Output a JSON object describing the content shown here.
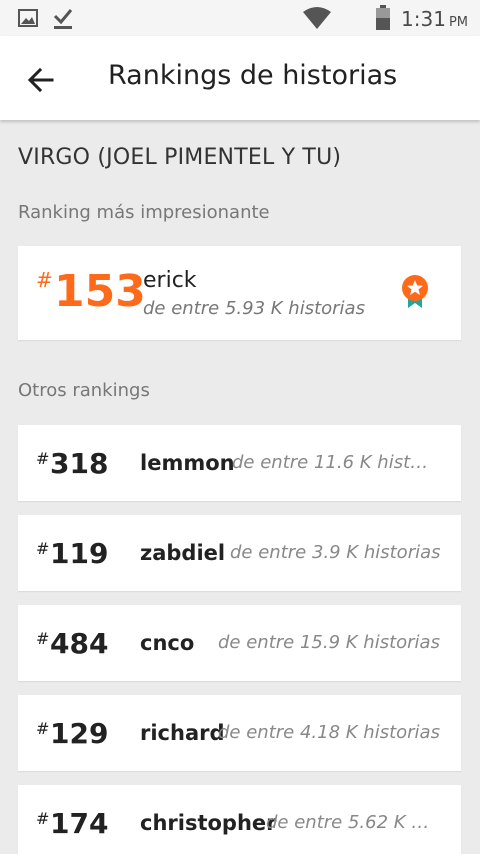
{
  "status_bar": {
    "time": "1:31",
    "ampm": "PM",
    "icons": [
      "image-icon",
      "download-done-icon",
      "wifi-icon",
      "battery-icon"
    ]
  },
  "app_bar": {
    "title": "Rankings de historias",
    "back_icon": "arrow-left-icon"
  },
  "story": {
    "title": "VIRGO (JOEL PIMENTEL Y TU)"
  },
  "best_ranking": {
    "section_label": "Ranking más impresionante",
    "hash": "#",
    "rank": "153",
    "tag": "erick",
    "subtitle": "de entre 5.93 K historias",
    "accent_color": "#ff6a1a",
    "badge_icon": "ribbon-medal-icon"
  },
  "other_rankings": {
    "section_label": "Otros rankings",
    "items": [
      {
        "hash": "#",
        "rank": "318",
        "tag": "lemmon",
        "subtitle": "de entre 11.6 K histor…"
      },
      {
        "hash": "#",
        "rank": "119",
        "tag": "zabdiel",
        "subtitle": "de entre 3.9 K historias"
      },
      {
        "hash": "#",
        "rank": "484",
        "tag": "cnco",
        "subtitle": "de entre 15.9 K historias"
      },
      {
        "hash": "#",
        "rank": "129",
        "tag": "richard",
        "subtitle": "de entre 4.18 K historias"
      },
      {
        "hash": "#",
        "rank": "174",
        "tag": "christopher",
        "subtitle": "de entre 5.62 K hi…"
      }
    ]
  }
}
